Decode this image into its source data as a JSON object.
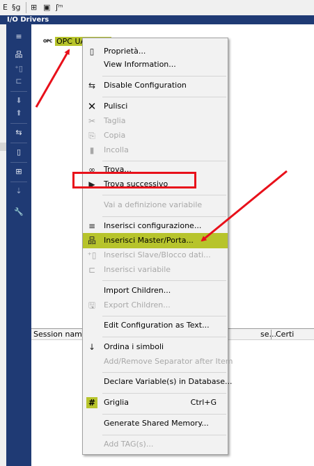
{
  "toolbar": {
    "icons": [
      "list-e-icon",
      "symbol-sg-icon",
      "node-tree-icon",
      "panel-icon",
      "signal-icon"
    ],
    "glyphs": [
      "E",
      "§g",
      "⊞",
      "▣",
      "ʃᵐ"
    ]
  },
  "panel": {
    "title": "I/O Drivers"
  },
  "side_toolbar": {
    "glyphs": [
      "≡",
      "品",
      "⁺▯",
      "⊏",
      "⬇",
      "⬆",
      "⇆",
      "▯",
      "⊞",
      "⇣",
      "🔧"
    ]
  },
  "tree": {
    "node_logo": "OPC",
    "node_label": "OPC UA Client"
  },
  "session_table": {
    "col_session": "Session name",
    "col_se": "se...",
    "col_cert": "Certi"
  },
  "context_menu": {
    "items": [
      {
        "label": "Proprietà...",
        "icon": "page-icon",
        "glyph": "▯"
      },
      {
        "label": "View Information...",
        "icon": "",
        "glyph": ""
      },
      {
        "label": "Disable Configuration",
        "icon": "link-toggle-icon",
        "glyph": "⇆"
      },
      {
        "label": "Pulisci",
        "icon": "clear-x-icon",
        "glyph": "✕"
      },
      {
        "label": "Taglia",
        "icon": "scissors-icon",
        "glyph": "✂"
      },
      {
        "label": "Copia",
        "icon": "copy-icon",
        "glyph": "⎘"
      },
      {
        "label": "Incolla",
        "icon": "paste-icon",
        "glyph": "▮"
      },
      {
        "label": "Trova...",
        "icon": "binoculars-icon",
        "glyph": "∞"
      },
      {
        "label": "Trova successivo",
        "icon": "find-next-icon",
        "glyph": "▶"
      },
      {
        "label": "Vai a definizione variabile",
        "icon": "",
        "glyph": ""
      },
      {
        "label": "Inserisci configurazione...",
        "icon": "insert-config-icon",
        "glyph": "≡"
      },
      {
        "label": "Inserisci Master/Porta...",
        "icon": "master-port-icon",
        "glyph": "品"
      },
      {
        "label": "Inserisci Slave/Blocco dati...",
        "icon": "slave-block-icon",
        "glyph": "⁺▯"
      },
      {
        "label": "Inserisci variabile",
        "icon": "variable-icon",
        "glyph": "⊏"
      },
      {
        "label": "Import Children...",
        "icon": "",
        "glyph": ""
      },
      {
        "label": "Export Children...",
        "icon": "save-icon",
        "glyph": "🖫"
      },
      {
        "label": "Edit Configuration as Text...",
        "icon": "",
        "glyph": ""
      },
      {
        "label": "Ordina i simboli",
        "icon": "sort-icon",
        "glyph": "↓"
      },
      {
        "label": "Add/Remove Separator after Item",
        "icon": "",
        "glyph": ""
      },
      {
        "label": "Declare Variable(s) in Database...",
        "icon": "",
        "glyph": ""
      },
      {
        "label": "Griglia",
        "icon": "grid-hash-icon",
        "glyph": "#",
        "shortcut": "Ctrl+G"
      },
      {
        "label": "Generate Shared Memory...",
        "icon": "",
        "glyph": ""
      },
      {
        "label": "Add TAG(s)...",
        "icon": "",
        "glyph": ""
      }
    ]
  },
  "colors": {
    "header_blue": "#1f3a74",
    "highlight": "#b7c42c",
    "annotation_red": "#e8101a"
  }
}
